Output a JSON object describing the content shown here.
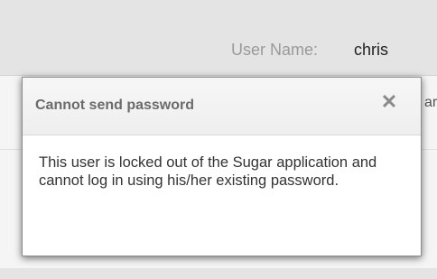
{
  "header": {
    "username_label": "User Name:",
    "username_value": "chris",
    "peek_text": "ar"
  },
  "dialog": {
    "title": "Cannot send password",
    "close_glyph": "✕",
    "message": "This user is locked out of the Sugar application and cannot log in using his/her existing password."
  },
  "colors": {
    "topbar_bg": "#e4e4e4",
    "dialog_title": "#6b6b6b",
    "dialog_body_text": "#333333"
  }
}
